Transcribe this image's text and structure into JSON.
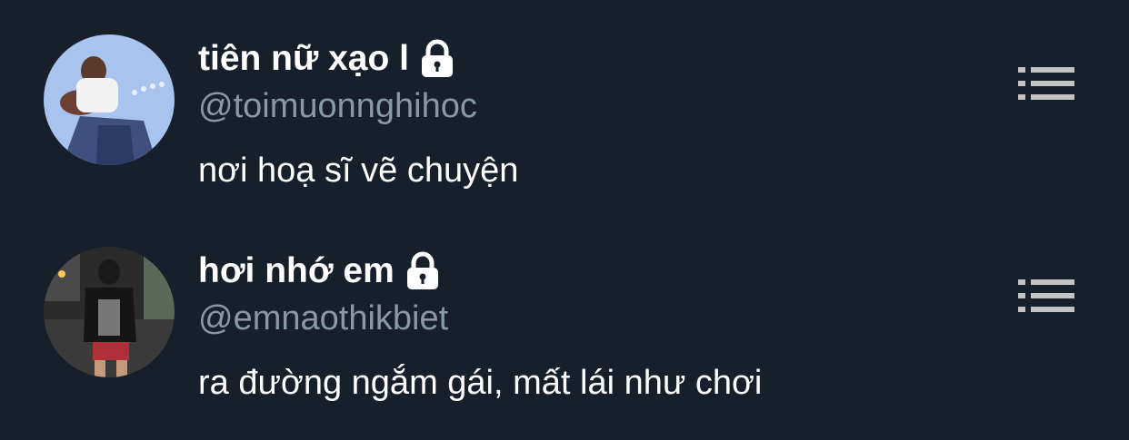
{
  "users": [
    {
      "display_name": "tiên nữ xạo l",
      "handle": "@toimuonnghihoc",
      "bio": "nơi hoạ sĩ vẽ chuyện",
      "avatar_icon": "avatar-photo",
      "protected": true
    },
    {
      "display_name": "hơi nhớ em",
      "handle": "@emnaothikbiet",
      "bio": "ra đường ngắm gái, mất lái như chơi",
      "avatar_icon": "avatar-photo",
      "protected": true
    }
  ],
  "icons": {
    "protected": "lock-icon",
    "menu": "list-menu-icon"
  },
  "colors": {
    "background": "#17202a",
    "text": "#ffffff",
    "handle_text": "#8899a6",
    "icon_gray": "#c4c4c4"
  }
}
